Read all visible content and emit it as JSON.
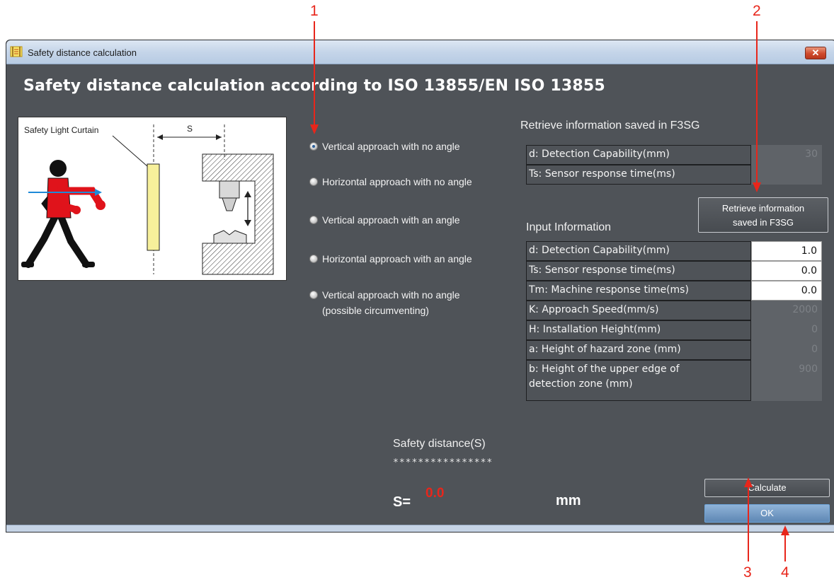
{
  "callouts": [
    "1",
    "2",
    "3",
    "4"
  ],
  "window": {
    "title": "Safety distance calculation",
    "close_label": "✕"
  },
  "heading": "Safety distance calculation according to ISO 13855/EN ISO 13855",
  "diagram": {
    "curtain_label": "Safety Light Curtain",
    "distance_label": "S"
  },
  "approach_options": [
    {
      "label": "Vertical approach with no angle",
      "checked": true
    },
    {
      "label": "Horizontal approach with no angle",
      "checked": false
    },
    {
      "label": "Vertical approach with an angle",
      "checked": false
    },
    {
      "label": "Horizontal approach with an angle",
      "checked": false
    },
    {
      "label_line1": "Vertical approach with no angle",
      "label_line2": "(possible circumventing)",
      "checked": false
    }
  ],
  "saved_info": {
    "title": "Retrieve information saved in F3SG",
    "rows": [
      {
        "label": "d: Detection Capability(mm)",
        "value": "30"
      },
      {
        "label": "Ts: Sensor response time(ms)",
        "value": ""
      }
    ],
    "retrieve_button_line1": "Retrieve information",
    "retrieve_button_line2": "saved in F3SG"
  },
  "input_info": {
    "title": "Input Information",
    "rows": [
      {
        "label": "d: Detection Capability(mm)",
        "value": "1.0",
        "editable": true
      },
      {
        "label": "Ts: Sensor response time(ms)",
        "value": "0.0",
        "editable": true
      },
      {
        "label": "Tm: Machine response time(ms)",
        "value": "0.0",
        "editable": true
      },
      {
        "label": "K: Approach Speed(mm/s)",
        "value": "2000",
        "editable": false
      },
      {
        "label": "H: Installation Height(mm)",
        "value": "0",
        "editable": false
      },
      {
        "label": "a: Height of hazard zone (mm)",
        "value": "0",
        "editable": false
      },
      {
        "label_line1": "b: Height of the upper edge of",
        "label_line2": "detection zone (mm)",
        "value": "900",
        "editable": false
      }
    ]
  },
  "result": {
    "title": "Safety distance(S)",
    "stars": "****************",
    "s_label": "S=",
    "s_value": "0.0",
    "unit": "mm"
  },
  "buttons": {
    "calculate": "Calculate",
    "ok": "OK"
  },
  "colors": {
    "callout": "#e8261b",
    "result_value": "#e8261b",
    "panel": "#4f5358"
  }
}
